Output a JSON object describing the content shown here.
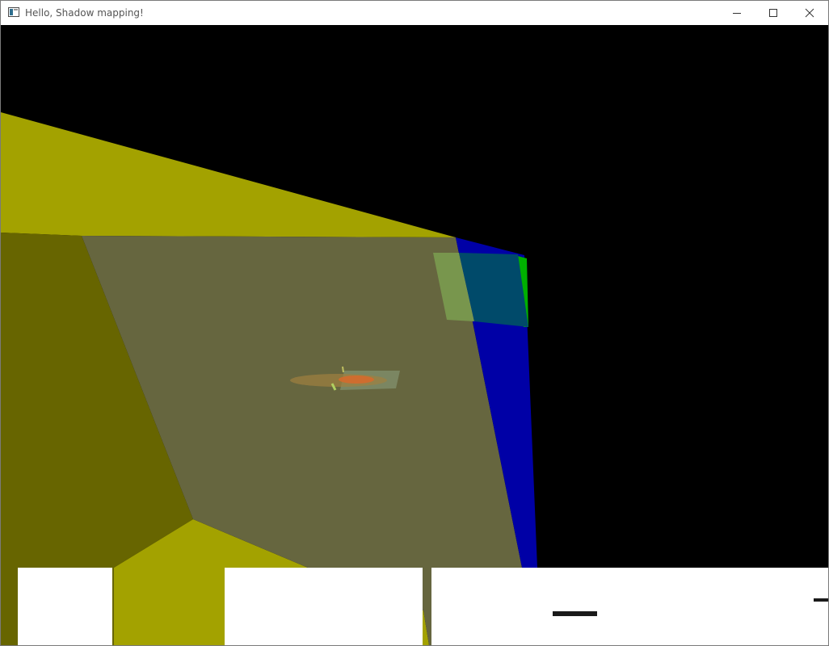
{
  "window": {
    "title": "Hello, Shadow mapping!"
  },
  "controls": {
    "minimize_icon": "minimize-icon",
    "maximize_icon": "maximize-icon",
    "close_icon": "close-icon"
  },
  "scene": {
    "background": "#000000",
    "colors": {
      "yellow_face": "#a3a200",
      "dark_yellow_face": "#676500",
      "floor_plane": "#66663f",
      "blue_wall": "#0000a6",
      "green_edge": "#00b000",
      "light_quad": "#5a7f55",
      "debug_panel": "#ffffff",
      "dash": "#1a1a1a"
    }
  }
}
